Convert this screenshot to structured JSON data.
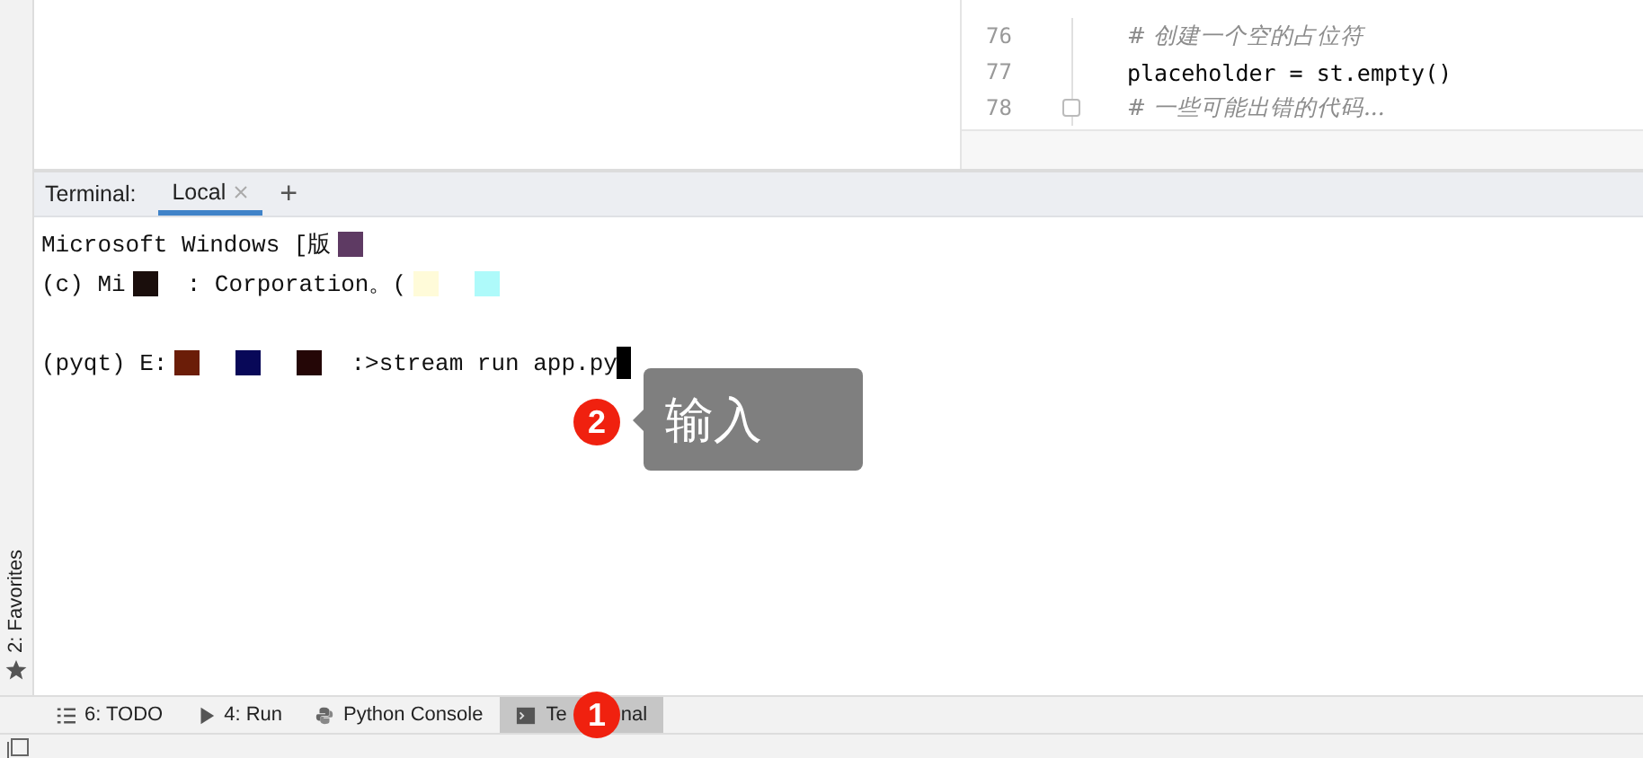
{
  "code_editor": {
    "lines": [
      {
        "number": "76",
        "text": "# 创建一个空的占位符",
        "kind": "comment",
        "fold": false
      },
      {
        "number": "77",
        "text": "placeholder = st.empty()",
        "kind": "code",
        "fold": false
      },
      {
        "number": "78",
        "text": "# 一些可能出错的代码...",
        "kind": "comment",
        "fold": true
      }
    ]
  },
  "terminal": {
    "label": "Terminal:",
    "tabs": [
      {
        "label": "Local",
        "selected": true,
        "closable": true
      }
    ],
    "add_button": "+",
    "lines": [
      {
        "kind": "text",
        "segments": [
          {
            "kind": "text",
            "text": "Microsoft Windows [版"
          },
          {
            "kind": "mask",
            "color": "#5e3a63"
          }
        ]
      },
      {
        "kind": "text",
        "segments": [
          {
            "kind": "text",
            "text": "(c) Mi"
          },
          {
            "kind": "mask",
            "color": "#1a0e0c"
          },
          {
            "kind": "text",
            "text": ": Corporation。("
          },
          {
            "kind": "mask",
            "color": "#fffbd9"
          },
          {
            "kind": "mask",
            "color": "#aefafa"
          }
        ]
      },
      {
        "kind": "blank"
      },
      {
        "kind": "text",
        "segments": [
          {
            "kind": "text",
            "text": "(pyqt) E:"
          },
          {
            "kind": "mask",
            "color": "#6b1d08"
          },
          {
            "kind": "mask",
            "color": "#080858"
          },
          {
            "kind": "mask",
            "color": "#240606"
          },
          {
            "kind": "text",
            "text": ":>stream run app.py"
          },
          {
            "kind": "cursor"
          }
        ]
      }
    ]
  },
  "callouts": [
    {
      "number": "2",
      "text": "输入"
    },
    {
      "number": "1"
    }
  ],
  "left_strip": {
    "label": "2: Favorites"
  },
  "tool_tabs": [
    {
      "label_parts": [
        "6: TODO"
      ],
      "selected": false
    },
    {
      "label_parts": [
        "4: Run"
      ],
      "selected": false
    },
    {
      "label_parts": [
        "Python Console"
      ],
      "selected": false
    },
    {
      "label_parts": [
        "Te",
        "nal"
      ],
      "selected": true
    }
  ]
}
